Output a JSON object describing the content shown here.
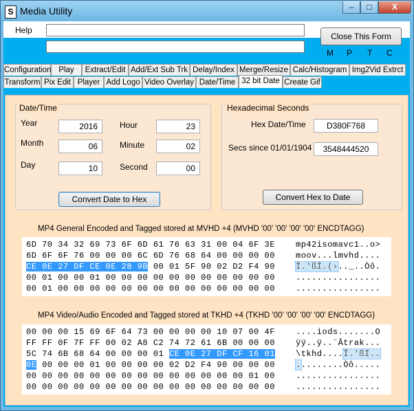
{
  "window": {
    "title": "Media Utility",
    "icon": "S",
    "min_glyph": "–",
    "max_glyph": "□",
    "close_glyph": "X"
  },
  "menu": {
    "help": "Help"
  },
  "textbox1": {
    "value": ""
  },
  "textbox2": {
    "value": ""
  },
  "close_form_label": "Close This Form",
  "indicators": [
    "M",
    "P",
    "T",
    "C"
  ],
  "tabs_row1": [
    "Configuration",
    "Play",
    "Extract/Edit",
    "Add/Ext Sub Trk",
    "Delay/Index",
    "Merge/Resize",
    "Calc/Histogram",
    "Img2Vid Extrct"
  ],
  "tabs_row2": [
    "Transform",
    "Pix Edit",
    "Player",
    "Add Logo",
    "Video Overlay",
    "Date/Time",
    "32 bit Date",
    "Create Gif"
  ],
  "active_tab": "32 bit Date",
  "datetime": {
    "legend": "Date/Time",
    "year_label": "Year",
    "year": "2016",
    "month_label": "Month",
    "month": "06",
    "day_label": "Day",
    "day": "10",
    "hour_label": "Hour",
    "hour": "23",
    "minute_label": "Minute",
    "minute": "02",
    "second_label": "Second",
    "second": "00",
    "convert_button": "Convert Date to Hex"
  },
  "hexsec": {
    "legend": "Hexadecimal Seconds",
    "hex_label": "Hex Date/Time",
    "hex_value": "D380F768",
    "secs_label": "Secs since 01/01/1904",
    "secs_value": "3548444520",
    "convert_button": "Convert Hex to Date"
  },
  "mvhd": {
    "title": "MP4 General Encoded and Tagged stored at MVHD +4 (MVHD '00' '00' '00' '00' ENCDTAGG)",
    "lines": [
      {
        "hex": [
          {
            "t": "6D 70 34 32 69 73 6F 6D 61 76 63 31 00 04 6F 3E"
          }
        ],
        "ascii": [
          {
            "t": "mp42isomavc1..o>"
          }
        ]
      },
      {
        "hex": [
          {
            "t": "6D 6F 6F 76 00 00 00 6C 6D 76 68 64 00 00 00 00"
          }
        ],
        "ascii": [
          {
            "t": "moov...lmvhd...."
          }
        ]
      },
      {
        "hex": [
          {
            "t": "CE 0E 27 DF CE 0E 28 9B",
            "sel": true
          },
          {
            "t": " 00 01 5F 90 02 D2 F4 90"
          }
        ],
        "ascii": [
          {
            "t": "Î.'ßÎ.(›",
            "sel": true
          },
          {
            "t": ".._..Òô."
          }
        ]
      },
      {
        "hex": [
          {
            "t": "00 01 00 00 01 00 00 00 00 00 00 00 00 00 00 00"
          }
        ],
        "ascii": [
          {
            "t": "................"
          }
        ]
      },
      {
        "hex": [
          {
            "t": "00 01 00 00 00 00 00 00 00 00 00 00 00 00 00 00"
          }
        ],
        "ascii": [
          {
            "t": "................"
          }
        ]
      }
    ]
  },
  "tkhd": {
    "title": "MP4 Video/Audio Encoded and Tagged stored at TKHD +4 (TKHD '00' '00' '00' '00' ENCDTAGG)",
    "lines": [
      {
        "hex": [
          {
            "t": "00 00 00 15 69 6F 64 73 00 00 00 00 10 07 00 4F"
          }
        ],
        "ascii": [
          {
            "t": "....iods.......O"
          }
        ]
      },
      {
        "hex": [
          {
            "t": "FF FF 0F 7F FF 00 02 A8 C2 74 72 61 6B 00 00 00"
          }
        ],
        "ascii": [
          {
            "t": "ÿÿ..ÿ..¨Âtrak..."
          }
        ]
      },
      {
        "hex": [
          {
            "t": "5C 74 6B 68 64 00 00 00 01 "
          },
          {
            "t": "CE 0E 27 DF CF 16 01",
            "sel": true
          }
        ],
        "ascii": [
          {
            "t": "\\tkhd...."
          },
          {
            "t": "Î.'ßÏ..",
            "sel": true
          }
        ]
      },
      {
        "hex": [
          {
            "t": "0E",
            "sel": true
          },
          {
            "t": " 00 00 00 01 00 00 00 00 02 D2 F4 90 00 00 00"
          }
        ],
        "ascii": [
          {
            "t": ".",
            "sel": true
          },
          {
            "t": "........Òô....."
          }
        ]
      },
      {
        "hex": [
          {
            "t": "00 00 00 00 00 00 00 00 00 00 00 00 00 00 01 00"
          }
        ],
        "ascii": [
          {
            "t": "................"
          }
        ]
      },
      {
        "hex": [
          {
            "t": "00 00 00 00 00 00 00 00 00 00 00 00 00 00 00 00"
          }
        ],
        "ascii": [
          {
            "t": "................"
          }
        ]
      }
    ]
  }
}
